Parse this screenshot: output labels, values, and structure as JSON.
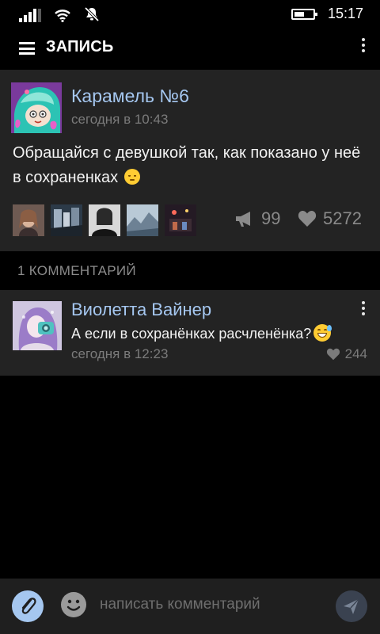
{
  "status_bar": {
    "time": "15:17",
    "icons": [
      "signal-icon",
      "wifi-icon",
      "silent-bell-icon",
      "battery-icon"
    ]
  },
  "header": {
    "title": "ЗАПИСЬ",
    "icons": [
      "hamburger-icon",
      "more-vertical-icon"
    ]
  },
  "post": {
    "author": "Карамель №6",
    "time": "сегодня в 10:43",
    "text": "Обращайся с девушкой так, как показано у неё в сохраненках",
    "text_emoji": "relieved-face-emoji",
    "photos": [
      {
        "name": "photo-1",
        "color": "#8a6a58"
      },
      {
        "name": "photo-2",
        "color": "#4a5a6a"
      },
      {
        "name": "photo-3",
        "color": "#2a2a2a"
      },
      {
        "name": "photo-4",
        "color": "#7f96a8"
      },
      {
        "name": "photo-5",
        "color": "#3a2a3a"
      }
    ],
    "reposts": "99",
    "likes": "5272"
  },
  "comments_header": "1 КОММЕНТАРИЙ",
  "comment": {
    "author": "Виолетта Вайнер",
    "text": "А если в сохранёнках расчленёнка?",
    "text_emoji": "grinning-sweat-emoji",
    "time": "сегодня в 12:23",
    "likes": "244"
  },
  "input": {
    "placeholder": "написать комментарий"
  },
  "colors": {
    "accent": "#a5c7f0",
    "card_bg": "#232323",
    "meta_gray": "#7b7b7b"
  }
}
